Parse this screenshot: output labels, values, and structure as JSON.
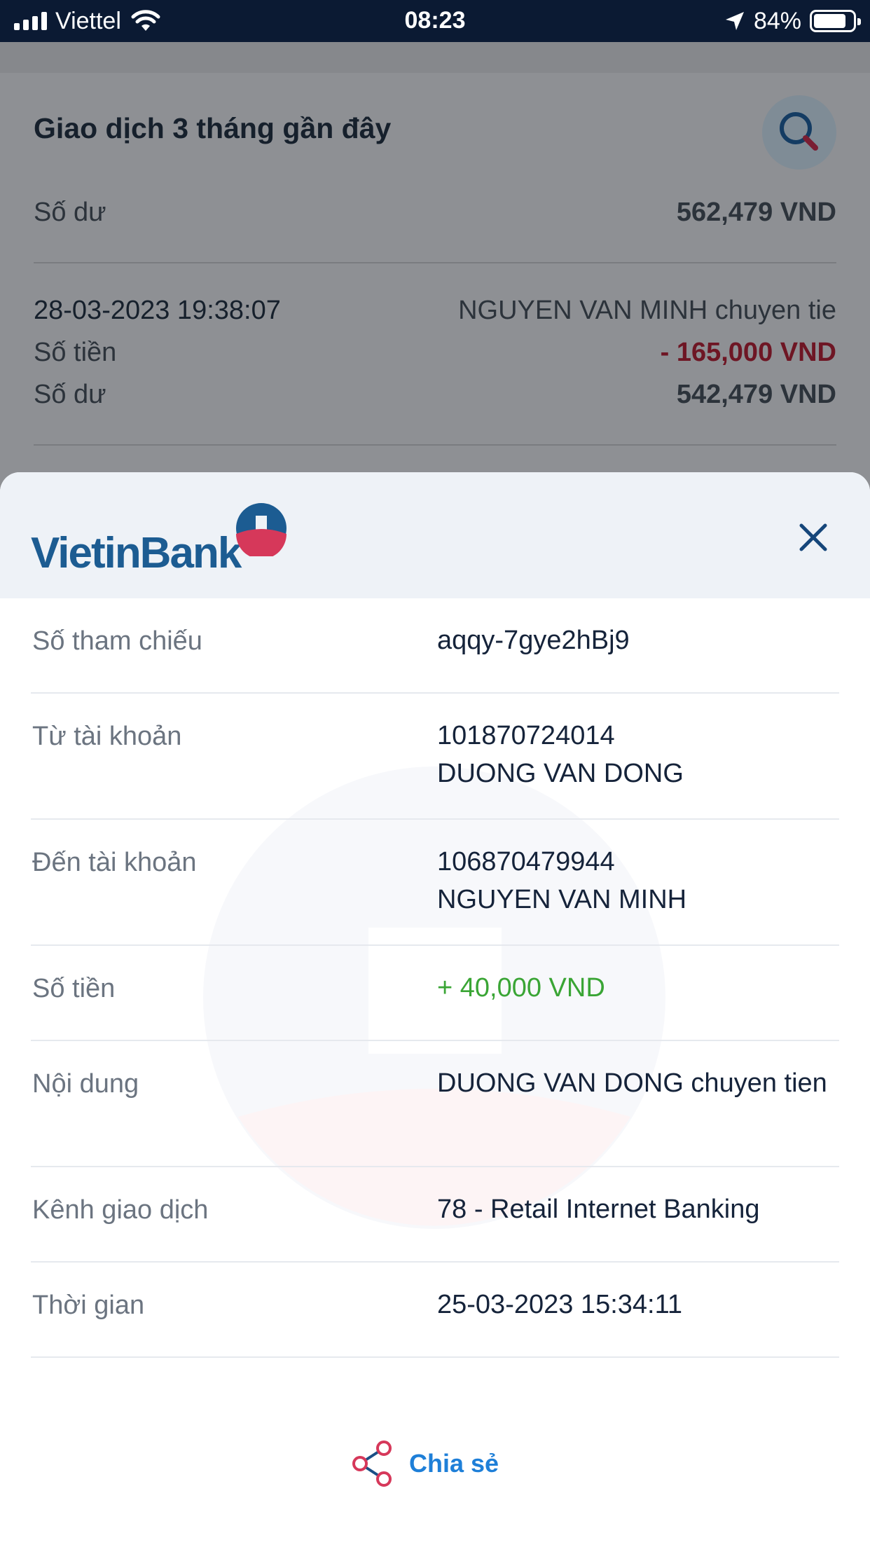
{
  "status_bar": {
    "carrier": "Viettel",
    "time": "08:23",
    "battery_percent": "84%",
    "battery_level": 0.84
  },
  "background": {
    "title": "Giao dịch 3 tháng gần đây",
    "balance_label": "Số dư",
    "balance_value": "562,479 VND",
    "transaction": {
      "datetime": "28-03-2023 19:38:07",
      "description": "NGUYEN VAN MINH chuyen tie",
      "amount_label": "Số tiền",
      "amount_value": "- 165,000 VND",
      "balance_label": "Số dư",
      "balance_value": "542,479 VND"
    }
  },
  "sheet": {
    "logo_text": "VietinBank",
    "rows": [
      {
        "label": "Số tham chiếu",
        "value": "aqqy-7gye2hBj9"
      },
      {
        "label": "Từ tài khoản",
        "value_line1": "101870724014",
        "value_line2": "DUONG VAN DONG"
      },
      {
        "label": "Đến tài khoản",
        "value_line1": "106870479944",
        "value_line2": "NGUYEN VAN MINH"
      },
      {
        "label": "Số tiền",
        "value": "+ 40,000 VND"
      },
      {
        "label": "Nội dung",
        "value": "DUONG VAN DONG chuyen tien"
      },
      {
        "label": "Kênh giao dịch",
        "value": "78 - Retail Internet Banking"
      },
      {
        "label": "Thời gian",
        "value": "25-03-2023 15:34:11"
      }
    ],
    "share_label": "Chia sẻ"
  },
  "colors": {
    "brand_blue": "#1c5c92",
    "brand_red": "#d6385a",
    "positive": "#3aa535",
    "negative": "#c8203e",
    "link": "#1e7fd8"
  },
  "icons": [
    "signal-icon",
    "wifi-icon",
    "location-arrow-icon",
    "battery-icon",
    "search-icon",
    "close-icon",
    "share-icon"
  ]
}
